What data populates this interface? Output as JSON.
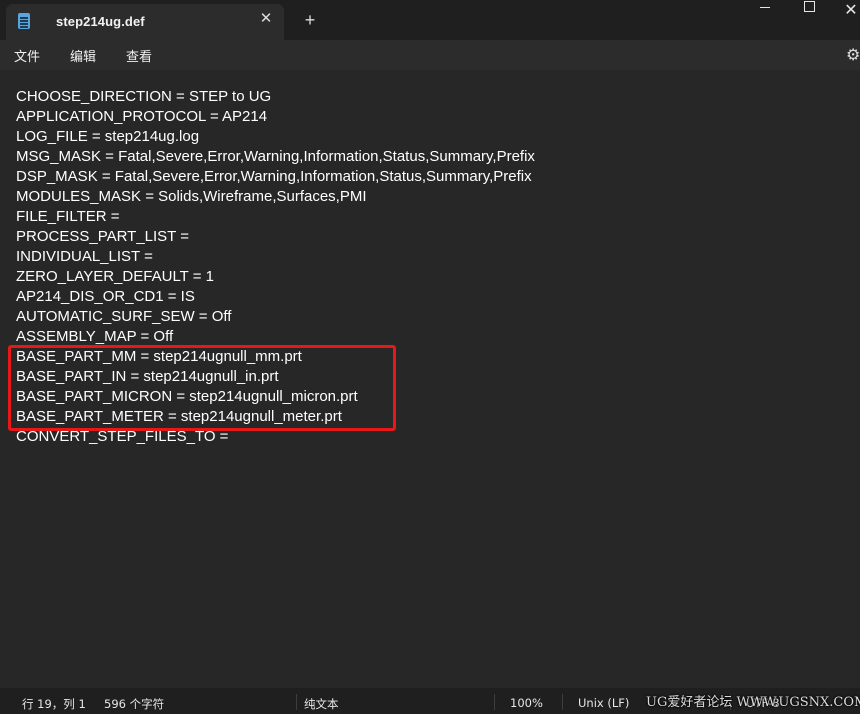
{
  "tab": {
    "title": "step214ug.def",
    "icon": "notepad-icon",
    "close_glyph": "✕",
    "new_glyph": "+"
  },
  "window_controls": {
    "close_glyph": "✕"
  },
  "menu": {
    "file": "文件",
    "edit": "编辑",
    "view": "查看",
    "settings_glyph": "⚙"
  },
  "editor": {
    "lines": [
      "CHOOSE_DIRECTION = STEP to UG",
      "APPLICATION_PROTOCOL = AP214",
      "LOG_FILE = step214ug.log",
      "MSG_MASK = Fatal,Severe,Error,Warning,Information,Status,Summary,Prefix",
      "DSP_MASK = Fatal,Severe,Error,Warning,Information,Status,Summary,Prefix",
      "MODULES_MASK = Solids,Wireframe,Surfaces,PMI",
      "FILE_FILTER =",
      "PROCESS_PART_LIST =",
      "INDIVIDUAL_LIST =",
      "ZERO_LAYER_DEFAULT = 1",
      "AP214_DIS_OR_CD1 = IS",
      "AUTOMATIC_SURF_SEW = Off",
      "ASSEMBLY_MAP = Off",
      "BASE_PART_MM = step214ugnull_mm.prt",
      "BASE_PART_IN = step214ugnull_in.prt",
      "BASE_PART_MICRON = step214ugnull_micron.prt",
      "BASE_PART_METER = step214ugnull_meter.prt",
      "CONVERT_STEP_FILES_TO ="
    ],
    "highlight_color": "#e81818"
  },
  "status": {
    "position": "行 19，列 1",
    "chars": "596 个字符",
    "format": "纯文本",
    "zoom": "100%",
    "eol": "Unix (LF)",
    "encoding": "UTF-8"
  },
  "watermark": "UG爱好者论坛 WWW.UGSNX.COM"
}
